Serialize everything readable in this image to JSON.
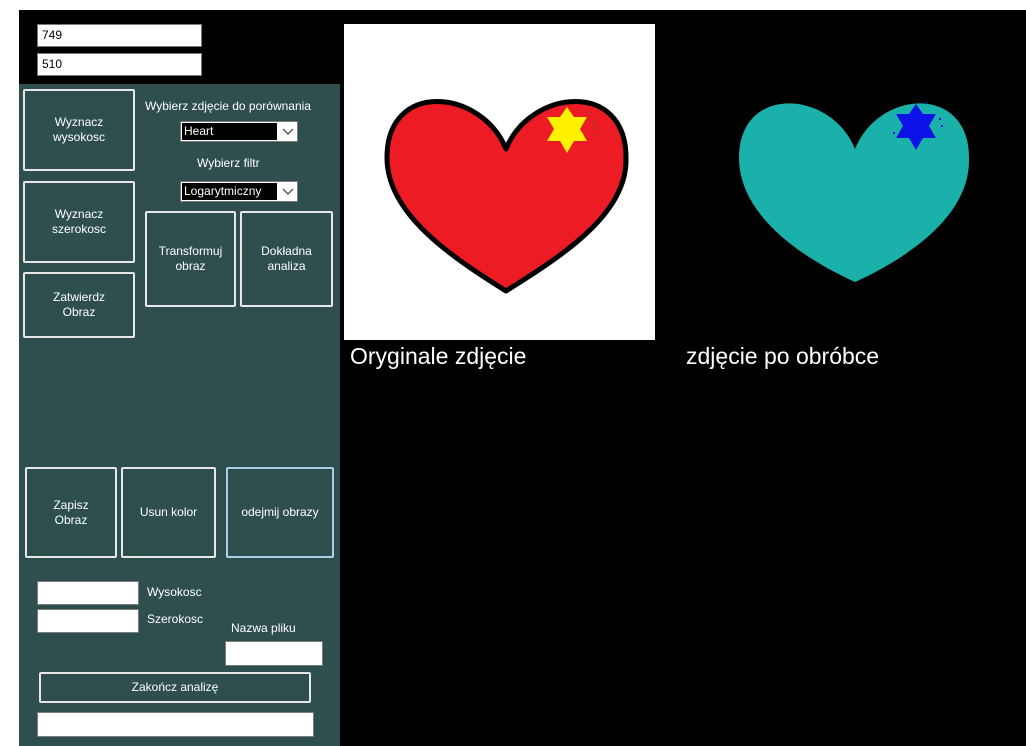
{
  "top_inputs": {
    "first_value": "749",
    "second_value": "510"
  },
  "controls": {
    "height_button": "Wyznacz\nwysokosc",
    "width_button": "Wyznacz\nszerokosc",
    "confirm_button": "Zatwierdz\nObraz",
    "compare_label": "Wybierz zdjęcie do porównania",
    "compare_select": "Heart",
    "filter_label": "Wybierz filtr",
    "filter_select": "Logarytmiczny",
    "transform_button": "Transformuj\nobraz",
    "analysis_button": "Dokładna\nanaliza",
    "save_button": "Zapisz\nObraz",
    "remove_color_button": "Usun kolor",
    "subtract_button": "odejmij obrazy",
    "height_label": "Wysokosc",
    "height_value": "",
    "width_label": "Szerokosc",
    "width_value": "",
    "filename_label": "Nazwa pliku",
    "filename_value": "",
    "finish_button": "Zakończ analizę",
    "bottom_value": ""
  },
  "images": {
    "original_caption": "Oryginale zdjęcie",
    "processed_caption": "zdjęcie po obróbce"
  },
  "colors": {
    "panel_bg": "#2f4f4f",
    "window_bg": "#000000",
    "heart_red": "#ed1c24",
    "star_yellow": "#fff200",
    "heart_teal": "#1ab1aa",
    "star_blue": "#0d12e6"
  },
  "icons": {
    "dropdown": "chevron-down-icon"
  }
}
